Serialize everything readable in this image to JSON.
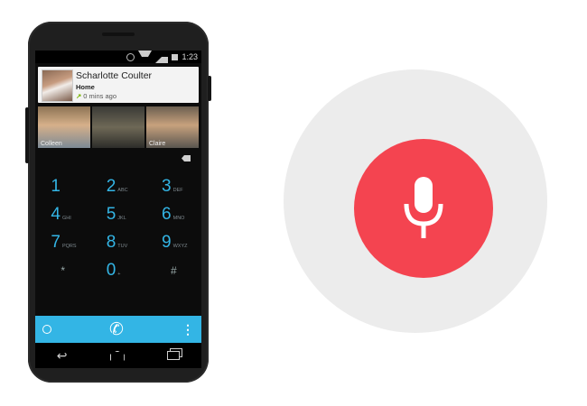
{
  "status_bar": {
    "time": "1:23"
  },
  "recent_call": {
    "name": "Scharlotte Coulter",
    "type": "Home",
    "time": "0 mins ago"
  },
  "favorites": [
    {
      "label": "Colleen"
    },
    {
      "label": ""
    },
    {
      "label": "Claire"
    }
  ],
  "dialpad": {
    "rows": [
      [
        {
          "digit": "1",
          "letters": ""
        },
        {
          "digit": "2",
          "letters": "ABC"
        },
        {
          "digit": "3",
          "letters": "DEF"
        }
      ],
      [
        {
          "digit": "4",
          "letters": "GHI"
        },
        {
          "digit": "5",
          "letters": "JKL"
        },
        {
          "digit": "6",
          "letters": "MNO"
        }
      ],
      [
        {
          "digit": "7",
          "letters": "PQRS"
        },
        {
          "digit": "8",
          "letters": "TUV"
        },
        {
          "digit": "9",
          "letters": "WXYZ"
        }
      ],
      [
        {
          "digit": "*",
          "letters": ""
        },
        {
          "digit": "0",
          "letters": "+"
        },
        {
          "digit": "#",
          "letters": ""
        }
      ]
    ]
  },
  "colors": {
    "accent": "#33b5e5",
    "mic_red": "#f44450",
    "mic_halo": "#ececec"
  },
  "icons": {
    "call_history": "clock-icon",
    "call": "phone-icon",
    "overflow": "overflow-menu-icon",
    "voice": "microphone-icon"
  }
}
